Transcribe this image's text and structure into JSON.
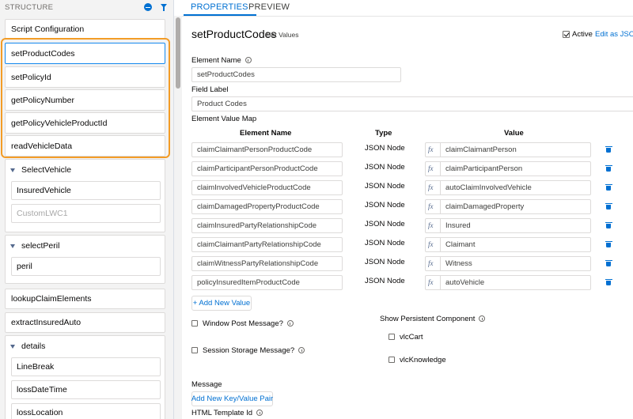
{
  "structure": {
    "title": "STRUCTURE",
    "icons": [
      "minus-circle-icon",
      "filter-icon"
    ],
    "top_item": "Script Configuration",
    "highlighted_items": [
      "setProductCodes",
      "setPolicyId",
      "getPolicyNumber",
      "getPolicyVehicleProductId",
      "readVehicleData"
    ],
    "select_vehicle": {
      "label": "SelectVehicle",
      "children": [
        "InsuredVehicle",
        "CustomLWC1"
      ]
    },
    "select_peril": {
      "label": "selectPeril",
      "children": [
        "peril"
      ]
    },
    "lookup_claim": "lookupClaimElements",
    "extract_insured": "extractInsuredAuto",
    "details": {
      "label": "details",
      "children": [
        "LineBreak",
        "lossDateTime",
        "lossLocation"
      ]
    }
  },
  "tabs": {
    "properties": "PROPERTIES",
    "preview": "PREVIEW"
  },
  "element": {
    "title": "setProductCodes",
    "type": "Set Values",
    "active_label": "Active",
    "active_checked": true,
    "edit_json": "Edit as JSON",
    "name_label": "Element Name",
    "name_value": "setProductCodes",
    "field_label_label": "Field Label",
    "field_label_value": "Product Codes",
    "value_map_label": "Element Value Map",
    "col_element_name": "Element Name",
    "col_type": "Type",
    "col_value": "Value",
    "rows": [
      {
        "name": "claimClaimantPersonProductCode",
        "type": "JSON Node",
        "fx": "fx",
        "value": "claimClaimantPerson"
      },
      {
        "name": "claimParticipantPersonProductCode",
        "type": "JSON Node",
        "fx": "fx",
        "value": "claimParticipantPerson"
      },
      {
        "name": "claimInvolvedVehicleProductCode",
        "type": "JSON Node",
        "fx": "fx",
        "value": "autoClaimInvolvedVehicle"
      },
      {
        "name": "claimDamagedPropertyProductCode",
        "type": "JSON Node",
        "fx": "fx",
        "value": "claimDamagedProperty"
      },
      {
        "name": "claimInsuredPartyRelationshipCode",
        "type": "JSON Node",
        "fx": "fx",
        "value": "Insured"
      },
      {
        "name": "claimClaimantPartyRelationshipCode",
        "type": "JSON Node",
        "fx": "fx",
        "value": "Claimant"
      },
      {
        "name": "claimWitnessPartyRelationshipCode",
        "type": "JSON Node",
        "fx": "fx",
        "value": "Witness"
      },
      {
        "name": "policyInsuredItemProductCode",
        "type": "JSON Node",
        "fx": "fx",
        "value": "autoVehicle"
      }
    ],
    "add_value_button": "+ Add New Value",
    "window_post_message": "Window Post Message?",
    "session_storage_message": "Session Storage Message?",
    "show_persistent_component": "Show Persistent Component",
    "persistent_options": [
      "vlcCart",
      "vlcKnowledge"
    ],
    "message_label": "Message",
    "add_key_value_button": "Add New Key/Value Pair",
    "html_template_label": "HTML Template Id"
  },
  "colors": {
    "accent": "#0070d2",
    "highlight": "#f39c26"
  }
}
